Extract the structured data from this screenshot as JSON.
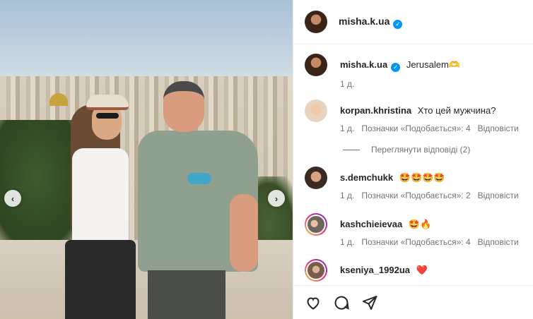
{
  "post": {
    "username": "misha.k.ua",
    "verified_mark": "✓"
  },
  "carousel": {
    "prev_label": "‹",
    "next_label": "›"
  },
  "caption": {
    "username": "misha.k.ua",
    "text": "Jerusalem🫶",
    "time": "1 д."
  },
  "comments": [
    {
      "username": "korpan.khristina",
      "text": "Хто цей мужчина?",
      "time": "1 д.",
      "likes": "Позначки «Подобається»: 4",
      "reply": "Відповісти",
      "view_replies": "Переглянути відповіді (2)"
    },
    {
      "username": "s.demchukk",
      "text": "🤩🤩🤩🤩",
      "time": "1 д.",
      "likes": "Позначки «Подобається»: 2",
      "reply": "Відповісти"
    },
    {
      "username": "kashchieievaa",
      "text": "🤩🔥",
      "time": "1 д.",
      "likes": "Позначки «Подобається»: 4",
      "reply": "Відповісти"
    },
    {
      "username": "kseniya_1992ua",
      "text": "❤️"
    }
  ],
  "icons": {
    "like": "heart-icon",
    "comment": "comment-icon",
    "share": "share-icon"
  },
  "colors": {
    "verified": "#0095f6",
    "meta_text": "#737373",
    "story_ring": "#ee2a7b"
  }
}
